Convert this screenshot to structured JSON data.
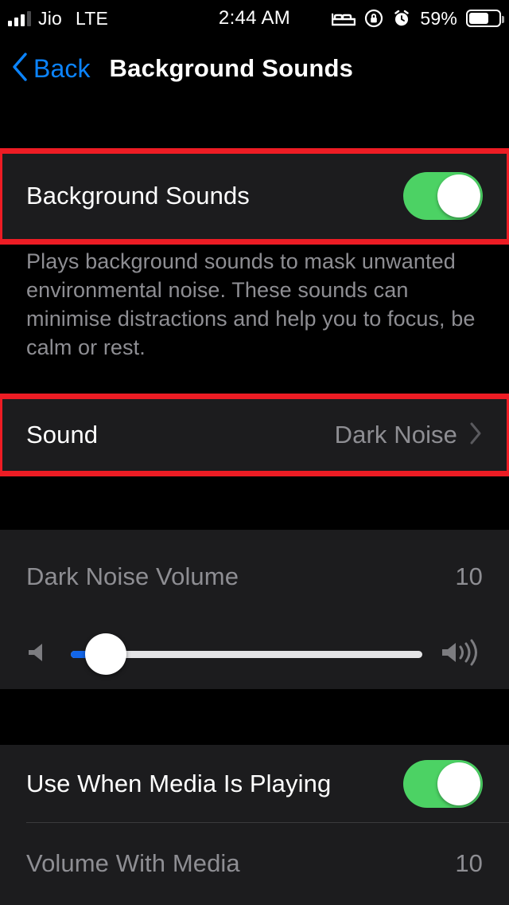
{
  "status_bar": {
    "carrier": "Jio",
    "radio_tech": "LTE",
    "time": "2:44 AM",
    "battery_percent": "59%",
    "icons": [
      "signal-bars-icon",
      "bed-icon",
      "rotation-lock-icon",
      "alarm-clock-icon",
      "battery-icon"
    ]
  },
  "nav": {
    "back_label": "Back",
    "title": "Background Sounds"
  },
  "sections": {
    "main_toggle": {
      "label": "Background Sounds",
      "enabled": true,
      "highlighted": true
    },
    "description": "Plays background sounds to mask unwanted environmental noise. These sounds can minimise distractions and help you to focus, be calm or rest.",
    "sound": {
      "label": "Sound",
      "value": "Dark Noise",
      "highlighted": true,
      "chevron": "chevron-right-icon"
    },
    "volume": {
      "label": "Dark Noise Volume",
      "value": "10",
      "slider_percent": 10,
      "left_icon": "speaker-low-icon",
      "right_icon": "speaker-high-icon"
    },
    "media": {
      "use_when_media_label": "Use When Media Is Playing",
      "use_when_media_enabled": true,
      "volume_with_media_label": "Volume With Media",
      "volume_with_media_value": "10"
    }
  },
  "colors": {
    "accent_blue": "#0b84ff",
    "toggle_green": "#4cd264",
    "slider_blue": "#1266ea",
    "highlight_red": "#ed1c24",
    "card_bg": "#1c1c1e",
    "page_bg": "#000000",
    "muted_text": "#8e8e93"
  }
}
